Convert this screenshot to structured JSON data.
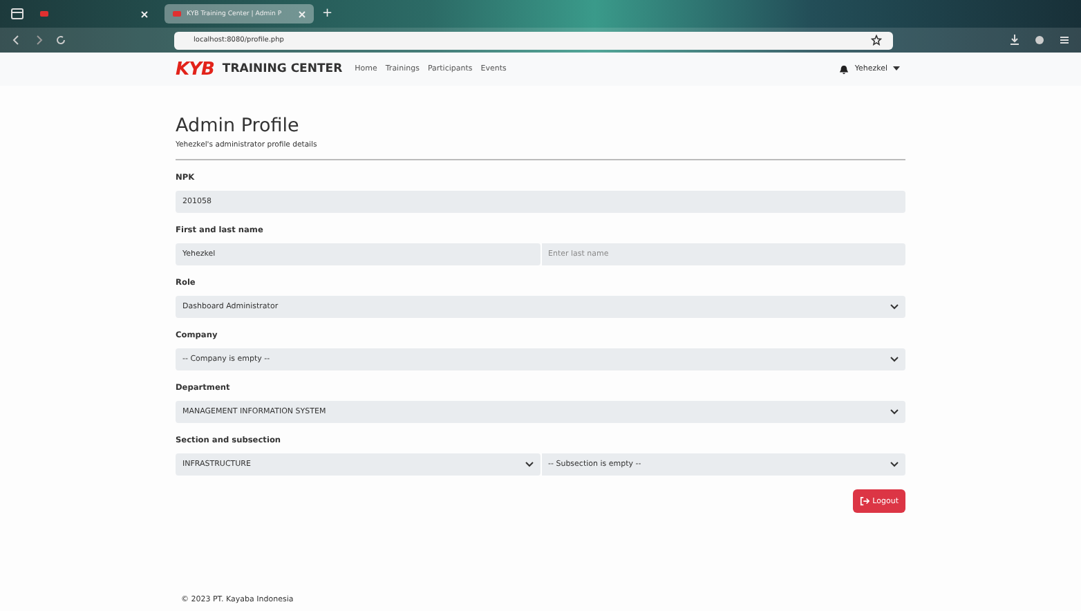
{
  "browser": {
    "tabs": [
      {
        "selected": false
      },
      {
        "title": "KYB Training Center | Admin P",
        "selected": true
      }
    ],
    "new_tab": "+",
    "url": "localhost:8080/profile.php"
  },
  "navbar": {
    "brand": "KYB",
    "brand_text": "TRAINING CENTER",
    "links": [
      "Home",
      "Trainings",
      "Participants",
      "Events"
    ],
    "user": "Yehezkel"
  },
  "page": {
    "title": "Admin Profile",
    "subtitle": "Yehezkel's administrator profile details",
    "fields": [
      {
        "label": "NPK",
        "kind": "text",
        "inputs": [
          {
            "value": "201058"
          }
        ]
      },
      {
        "label": "First and last name",
        "kind": "text",
        "inputs": [
          {
            "value": "Yehezkel"
          },
          {
            "placeholder": "Enter last name"
          }
        ]
      },
      {
        "label": "Role",
        "kind": "select",
        "inputs": [
          {
            "value": "Dashboard Administrator"
          }
        ]
      },
      {
        "label": "Company",
        "kind": "select",
        "inputs": [
          {
            "value": "-- Company is empty --"
          }
        ]
      },
      {
        "label": "Department",
        "kind": "select",
        "inputs": [
          {
            "value": "MANAGEMENT INFORMATION SYSTEM"
          }
        ]
      },
      {
        "label": "Section and subsection",
        "kind": "select",
        "inputs": [
          {
            "value": "INFRASTRUCTURE"
          },
          {
            "value": "-- Subsection is empty --"
          }
        ]
      }
    ],
    "logout": "Logout"
  },
  "footer": "© 2023 PT. Kayaba Indonesia"
}
